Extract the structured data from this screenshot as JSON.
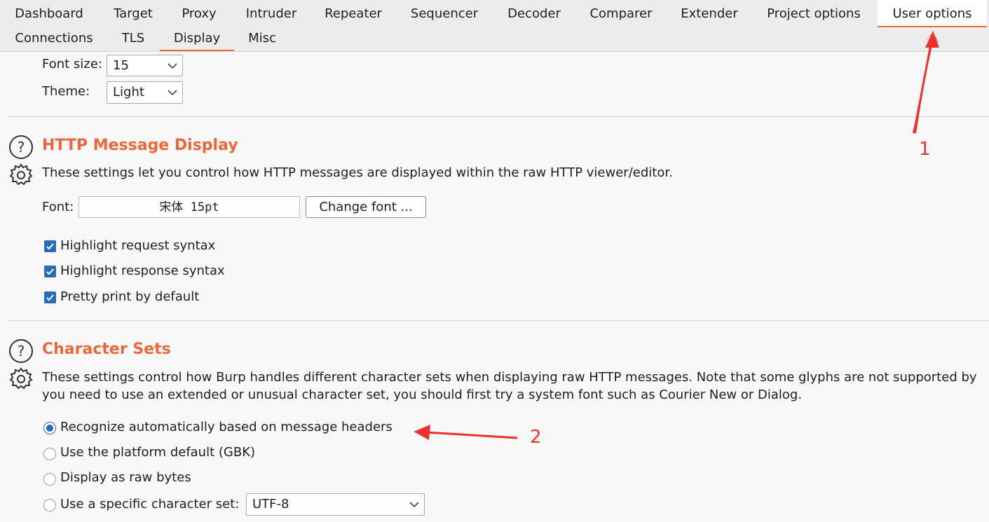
{
  "tabs": [
    "Dashboard",
    "Target",
    "Proxy",
    "Intruder",
    "Repeater",
    "Sequencer",
    "Decoder",
    "Comparer",
    "Extender",
    "Project options",
    "User options"
  ],
  "active_tab": "User options",
  "subtabs": [
    "Connections",
    "TLS",
    "Display",
    "Misc"
  ],
  "active_subtab": "Display",
  "appearance": {
    "font_size_label": "Font size:",
    "font_size_value": "15",
    "theme_label": "Theme:",
    "theme_value": "Light"
  },
  "http_display": {
    "title": "HTTP Message Display",
    "description": "These settings let you control how HTTP messages are displayed within the raw HTTP viewer/editor.",
    "font_label": "Font:",
    "font_value": "宋体 15pt",
    "change_font_button": "Change font ...",
    "checkboxes": [
      {
        "label": "Highlight request syntax",
        "checked": true
      },
      {
        "label": "Highlight response syntax",
        "checked": true
      },
      {
        "label": "Pretty print by default",
        "checked": true
      }
    ]
  },
  "character_sets": {
    "title": "Character Sets",
    "description_line1": "These settings control how Burp handles different character sets when displaying raw HTTP messages. Note that some glyphs are not supported by",
    "description_line2": "you need to use an extended or unusual character set, you should first try a system font such as Courier New or Dialog.",
    "options": [
      {
        "label": "Recognize automatically based on message headers",
        "selected": true
      },
      {
        "label": "Use the platform default (GBK)",
        "selected": false
      },
      {
        "label": "Display as raw bytes",
        "selected": false
      },
      {
        "label": "Use a specific character set:",
        "selected": false
      }
    ],
    "charset_value": "UTF-8"
  },
  "annotations": {
    "one": "1",
    "two": "2"
  },
  "colors": {
    "accent": "#e9683b",
    "checkbox": "#2a6bb6",
    "annotation": "#e8322e"
  },
  "icons": [
    "help-icon",
    "gear-icon",
    "chevron-down-icon",
    "checkmark-icon",
    "arrow-annotation"
  ]
}
